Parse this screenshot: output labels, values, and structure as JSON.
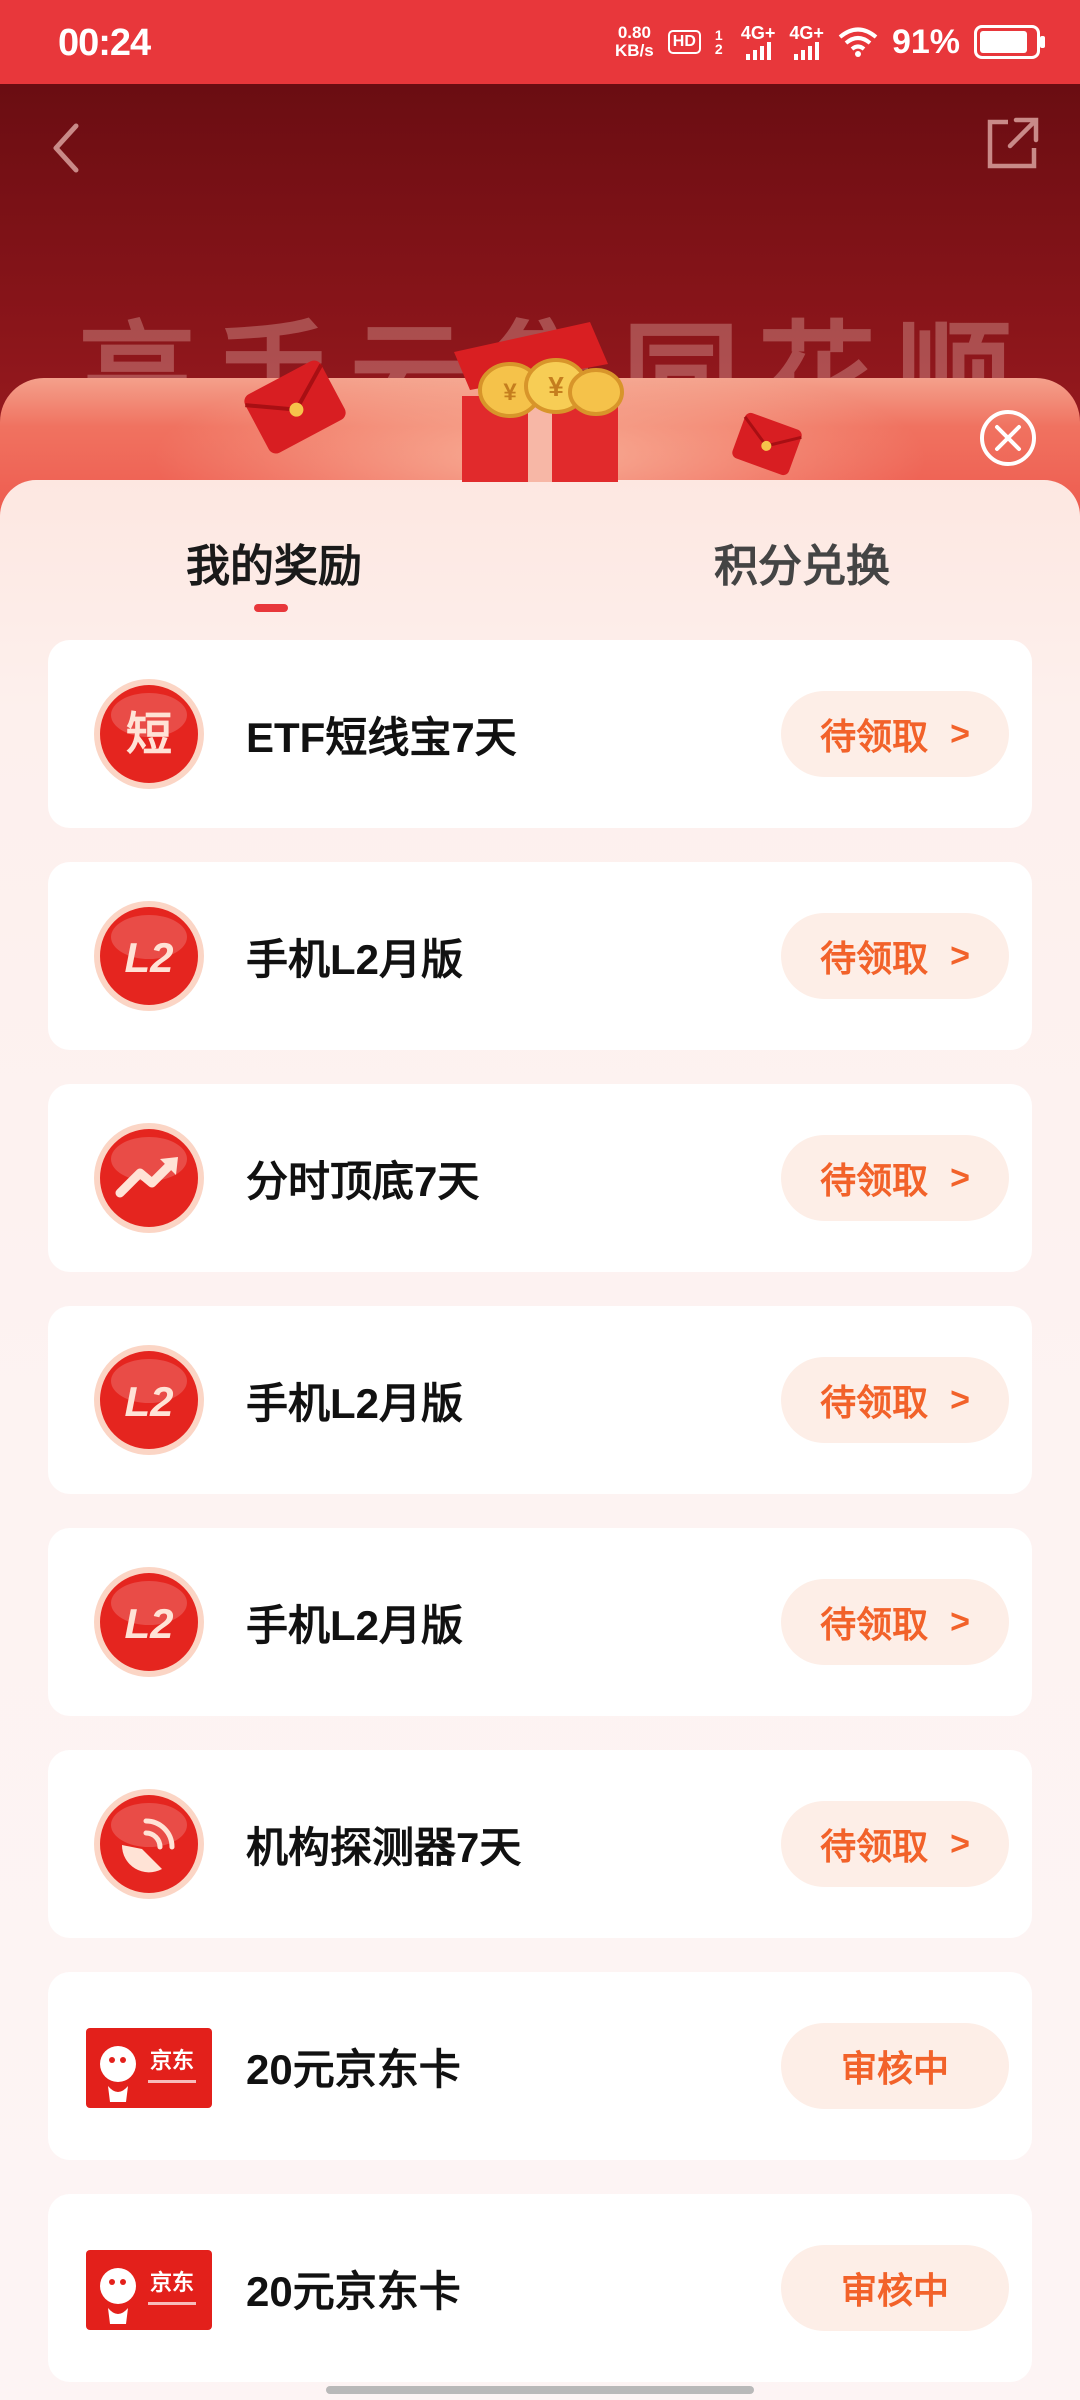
{
  "status_bar": {
    "time": "00:24",
    "speed_value": "0.80",
    "speed_unit": "KB/s",
    "hd": "HD",
    "sim_marks": "1 2",
    "sig1": "4G+",
    "sig2": "4G+",
    "battery": "91%"
  },
  "header": {
    "title": "高手云集同花顺"
  },
  "tabs": [
    {
      "label": "我的奖励",
      "active": true
    },
    {
      "label": "积分兑换",
      "active": false
    }
  ],
  "rewards": [
    {
      "name": "ETF短线宝7天",
      "icon": "short-icon",
      "icon_glyph": "短",
      "status": "待领取",
      "chevron": ">"
    },
    {
      "name": "手机L2月版",
      "icon": "l2-icon",
      "icon_glyph": "L2",
      "status": "待领取",
      "chevron": ">"
    },
    {
      "name": "分时顶底7天",
      "icon": "trend-icon",
      "icon_glyph": "",
      "status": "待领取",
      "chevron": ">"
    },
    {
      "name": "手机L2月版",
      "icon": "l2-icon",
      "icon_glyph": "L2",
      "status": "待领取",
      "chevron": ">"
    },
    {
      "name": "手机L2月版",
      "icon": "l2-icon",
      "icon_glyph": "L2",
      "status": "待领取",
      "chevron": ">"
    },
    {
      "name": "机构探测器7天",
      "icon": "radar-icon",
      "icon_glyph": "",
      "status": "待领取",
      "chevron": ">"
    },
    {
      "name": "20元京东卡",
      "icon": "jd-card-icon",
      "icon_glyph": "京东",
      "status": "审核中",
      "chevron": ""
    },
    {
      "name": "20元京东卡",
      "icon": "jd-card-icon",
      "icon_glyph": "京东",
      "status": "审核中",
      "chevron": ""
    }
  ],
  "colors": {
    "accent": "#e8373b",
    "status_text": "#f2622a",
    "button_bg": "#fdeee7"
  }
}
